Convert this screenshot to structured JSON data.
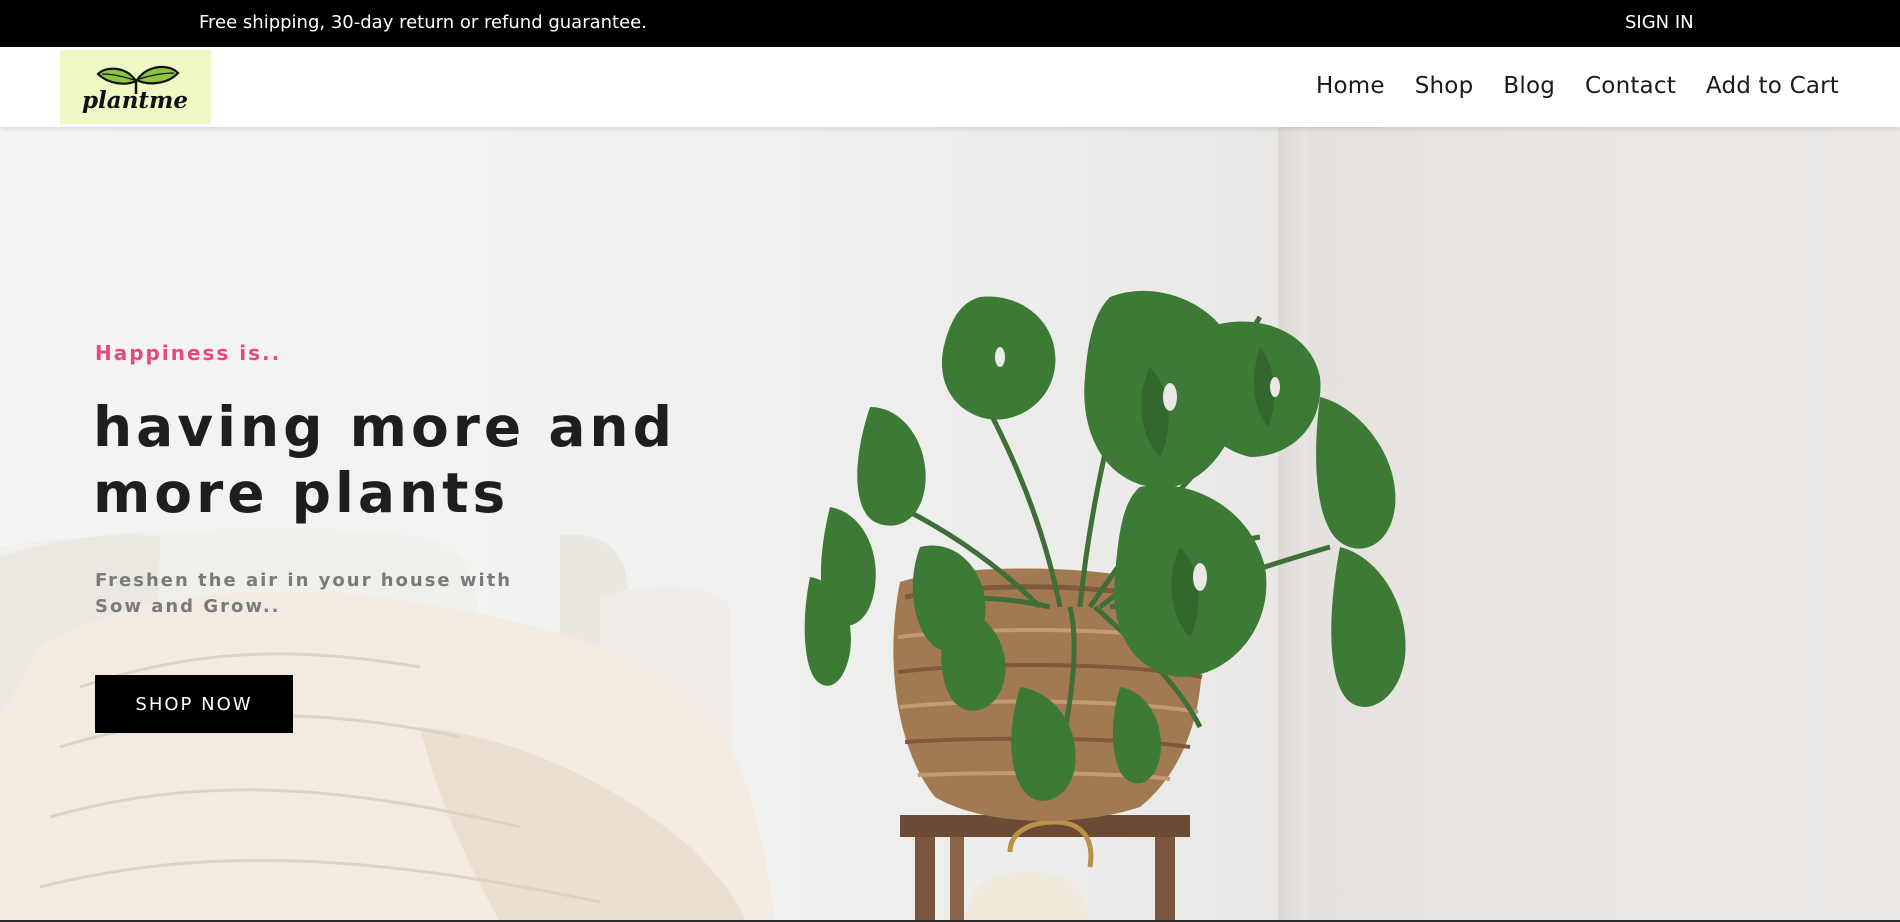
{
  "announcement": {
    "text": "Free shipping, 30-day return or refund guarantee.",
    "signin_label": "SIGN IN"
  },
  "header": {
    "logo_text": "plantme",
    "logo_icon": "sprout-icon",
    "nav": [
      {
        "label": "Home"
      },
      {
        "label": "Shop"
      },
      {
        "label": "Blog"
      },
      {
        "label": "Contact"
      },
      {
        "label": "Add to Cart"
      }
    ]
  },
  "hero": {
    "eyebrow": "Happiness is..",
    "headline_line1": "having more and",
    "headline_line2": "more plants",
    "subtext_line1": "Freshen the air in your house with",
    "subtext_line2": "Sow and Grow..",
    "cta_label": "SHOP NOW",
    "image": "monstera-plant-in-wicker-basket"
  },
  "colors": {
    "topbar": "#000000",
    "accent_pink": "#e8497a",
    "logo_bg": "#eef8c4",
    "cta_bg": "#000000"
  }
}
